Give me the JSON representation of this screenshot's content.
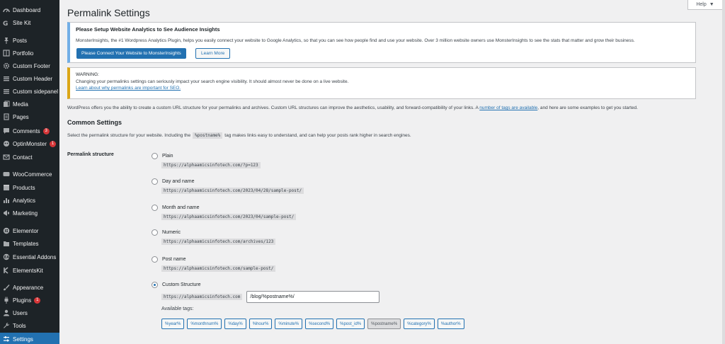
{
  "sidebar": {
    "items": [
      {
        "label": "Dashboard",
        "icon": "dashboard-icon"
      },
      {
        "label": "Site Kit",
        "icon": "sitekit-icon"
      },
      {
        "label": "Posts",
        "icon": "pin-icon"
      },
      {
        "label": "Portfolio",
        "icon": "portfolio-icon"
      },
      {
        "label": "Custom Footer",
        "icon": "gear-icon"
      },
      {
        "label": "Custom Header",
        "icon": "list-icon"
      },
      {
        "label": "Custom sidepanel",
        "icon": "list-icon"
      },
      {
        "label": "Media",
        "icon": "media-icon"
      },
      {
        "label": "Pages",
        "icon": "page-icon"
      },
      {
        "label": "Comments",
        "icon": "comment-icon",
        "badge": "3"
      },
      {
        "label": "OptinMonster",
        "icon": "optinmonster-icon",
        "badge": "1"
      },
      {
        "label": "Contact",
        "icon": "mail-icon"
      },
      {
        "label": "WooCommerce",
        "icon": "woo-icon"
      },
      {
        "label": "Products",
        "icon": "box-icon"
      },
      {
        "label": "Analytics",
        "icon": "bar-chart-icon"
      },
      {
        "label": "Marketing",
        "icon": "megaphone-icon"
      },
      {
        "label": "Elementor",
        "icon": "elementor-icon"
      },
      {
        "label": "Templates",
        "icon": "folder-icon"
      },
      {
        "label": "Essential Addons",
        "icon": "ea-icon"
      },
      {
        "label": "ElementsKit",
        "icon": "ek-icon"
      },
      {
        "label": "Appearance",
        "icon": "brush-icon"
      },
      {
        "label": "Plugins",
        "icon": "plug-icon",
        "badge": "1"
      },
      {
        "label": "Users",
        "icon": "user-icon"
      },
      {
        "label": "Tools",
        "icon": "wrench-icon"
      },
      {
        "label": "Settings",
        "icon": "settings-icon",
        "active": true
      }
    ]
  },
  "header": {
    "title": "Permalink Settings",
    "help_label": "Help"
  },
  "notice_info": {
    "title": "Please Setup Website Analytics to See Audience Insights",
    "body": "MonsterInsights, the #1 Wordpress Analytics Plugin, helps you easily connect your website to Google Analytics, so that you can see how people find and use your website. Over 3 million website owners use MonsterInsights to see the stats that matter and grow their business.",
    "primary_button": "Please Connect Your Website to MonsterInsights",
    "secondary_button": "Learn More"
  },
  "notice_warn": {
    "title": "WARNING:",
    "body": "Changing your permalinks settings can seriously impact your search engine visibility. It should almost never be done on a live website.",
    "link": "Learn about why permalinks are important for SEO."
  },
  "intro": {
    "before": "WordPress offers you the ability to create a custom URL structure for your permalinks and archives. Custom URL structures can improve the aesthetics, usability, and forward-compatibility of your links. A",
    "link": "number of tags are available",
    "after": ", and here are some examples to get you started."
  },
  "common": {
    "title": "Common Settings",
    "desc_before": "Select the permalink structure for your website. Including the",
    "desc_code": "%postname%",
    "desc_after": "tag makes links easy to understand, and can help your posts rank higher in search engines.",
    "row_label": "Permalink structure"
  },
  "options": [
    {
      "label": "Plain",
      "sample": "https://alphaamicsinfotech.com/?p=123",
      "checked": false
    },
    {
      "label": "Day and name",
      "sample": "https://alphaamicsinfotech.com/2023/04/28/sample-post/",
      "checked": false
    },
    {
      "label": "Month and name",
      "sample": "https://alphaamicsinfotech.com/2023/04/sample-post/",
      "checked": false
    },
    {
      "label": "Numeric",
      "sample": "https://alphaamicsinfotech.com/archives/123",
      "checked": false
    },
    {
      "label": "Post name",
      "sample": "https://alphaamicsinfotech.com/sample-post/",
      "checked": false
    },
    {
      "label": "Custom Structure",
      "checked": true
    }
  ],
  "custom": {
    "base": "https://alphaamicsinfotech.com",
    "value": "/blog/%postname%/",
    "available_label": "Available tags:"
  },
  "tags": [
    {
      "label": "%year%"
    },
    {
      "label": "%monthnum%"
    },
    {
      "label": "%day%"
    },
    {
      "label": "%hour%"
    },
    {
      "label": "%minute%"
    },
    {
      "label": "%second%"
    },
    {
      "label": "%post_id%"
    },
    {
      "label": "%postname%",
      "active": true
    },
    {
      "label": "%category%"
    },
    {
      "label": "%author%"
    }
  ],
  "colors": {
    "sidebar_bg": "#1d2327",
    "accent": "#2271b1",
    "badge": "#d63638",
    "warning": "#dba617",
    "info": "#72aee6"
  }
}
